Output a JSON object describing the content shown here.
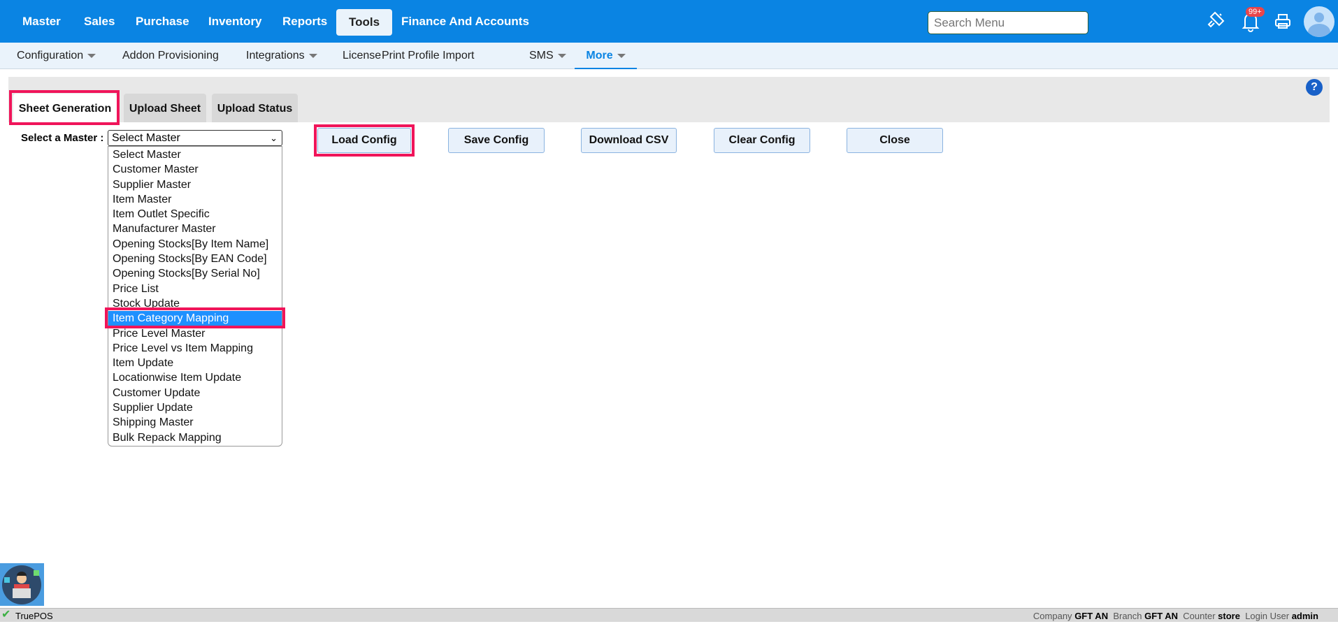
{
  "topnav": {
    "items": [
      "Master",
      "Sales",
      "Purchase",
      "Inventory",
      "Reports",
      "Tools",
      "Finance And Accounts"
    ],
    "active": "Tools",
    "search_placeholder": "Search Menu",
    "badge": "99+"
  },
  "subnav": {
    "items": [
      "Configuration",
      "Addon Provisioning",
      "Integrations",
      "License",
      "Print Profile Import",
      "SMS",
      "More"
    ]
  },
  "tabs": [
    "Sheet Generation",
    "Upload Sheet",
    "Upload Status"
  ],
  "form": {
    "label": "Select a Master :",
    "selected": "Select Master",
    "options": [
      "Select Master",
      "Customer Master",
      "Supplier Master",
      "Item Master",
      "Item Outlet Specific",
      "Manufacturer Master",
      "Opening Stocks[By Item Name]",
      "Opening Stocks[By EAN Code]",
      "Opening Stocks[By Serial No]",
      "Price List",
      "Stock Update",
      "Item Category Mapping",
      "Price Level Master",
      "Price Level vs Item Mapping",
      "Item Update",
      "Locationwise Item Update",
      "Customer Update",
      "Supplier Update",
      "Shipping Master",
      "Bulk Repack Mapping"
    ],
    "highlighted": "Item Category Mapping"
  },
  "buttons": {
    "load": "Load Config",
    "save": "Save Config",
    "download": "Download CSV",
    "clear": "Clear Config",
    "close": "Close"
  },
  "help": "?",
  "status": {
    "app": "TruePOS",
    "company_label": "Company",
    "company": "GFT AN",
    "branch_label": "Branch",
    "branch": "GFT AN",
    "counter_label": "Counter",
    "counter": "store",
    "user_label": "Login User",
    "user": "admin"
  },
  "colors": {
    "primary": "#0a84e3",
    "highlight": "#f0155a"
  }
}
